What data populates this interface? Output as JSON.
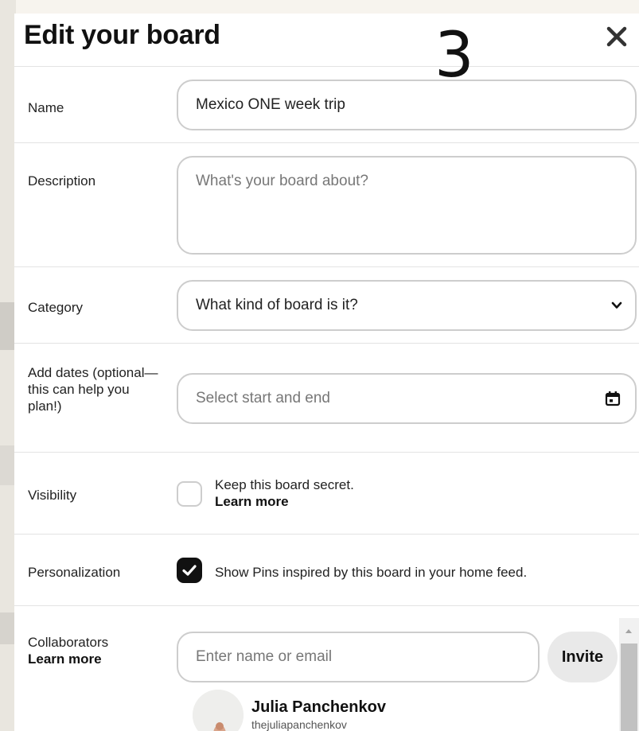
{
  "modal": {
    "title": "Edit your board",
    "step_number": "3"
  },
  "name": {
    "label": "Name",
    "value": "Mexico ONE week trip"
  },
  "description": {
    "label": "Description",
    "placeholder": "What's your board about?"
  },
  "category": {
    "label": "Category",
    "placeholder": "What kind of board is it?"
  },
  "dates": {
    "label": "Add dates (optional— this can help you plan!)",
    "label_line1": "Add dates (optional—",
    "label_line2": "this can help you",
    "label_line3": "plan!)",
    "placeholder": "Select start and end"
  },
  "visibility": {
    "label": "Visibility",
    "checkbox_text": "Keep this board secret.",
    "link": "Learn more",
    "checked": false
  },
  "personalization": {
    "label": "Personalization",
    "checkbox_text": "Show Pins inspired by this board in your home feed.",
    "checked": true
  },
  "collaborators": {
    "label": "Collaborators",
    "link": "Learn more",
    "input_placeholder": "Enter name or email",
    "invite_label": "Invite",
    "list": [
      {
        "name": "Julia Panchenkov",
        "handle": "thejuliapanchenkov"
      }
    ]
  },
  "icons": {
    "close": "close-icon",
    "chevron": "chevron-down-icon",
    "calendar": "calendar-icon",
    "check": "check-icon"
  },
  "colors": {
    "page_background": "#f7f4ee",
    "border": "#cdcdcd",
    "checked": "#111111",
    "invite_button": "#e9e9e9"
  }
}
